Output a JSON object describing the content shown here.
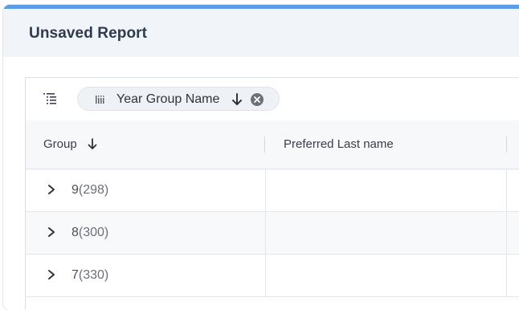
{
  "report": {
    "title": "Unsaved Report"
  },
  "toolbar": {
    "group_chip": {
      "label": "Year Group Name",
      "sort_direction": "descending"
    }
  },
  "columns": [
    {
      "label": "Group",
      "sorted": "descending"
    },
    {
      "label": "Preferred Last name"
    }
  ],
  "rows": [
    {
      "value": "9",
      "count": "(298)"
    },
    {
      "value": "8",
      "count": "(300)"
    },
    {
      "value": "7",
      "count": "(330)"
    }
  ],
  "colors": {
    "accent": "#5b9ce9",
    "header_bg": "#f1f4f8",
    "text": "#2e3a4e"
  }
}
